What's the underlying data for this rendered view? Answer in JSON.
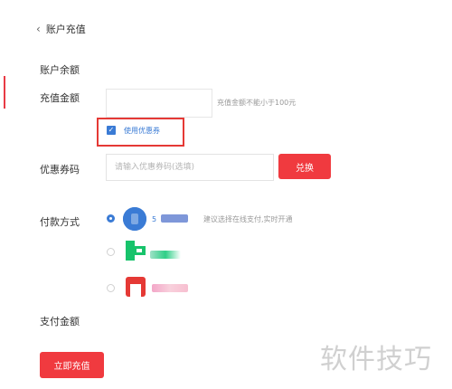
{
  "header": {
    "back_label": "账户充值"
  },
  "fields": {
    "balance_label": "账户余额",
    "amount_label": "充值金额",
    "amount_value": "",
    "amount_hint": "充值金额不能小于100元",
    "use_coupon_label": "使用优惠券",
    "use_coupon_checked": true,
    "coupon_label": "优惠券码",
    "coupon_placeholder": "请输入优惠券码(选填)",
    "redeem_label": "兑换",
    "payment_label": "付款方式",
    "payment_methods": [
      {
        "selected": true,
        "icon": "blue-circle-icon",
        "name_prefix": "5",
        "hint": "建议选择在线支付,实时开通"
      },
      {
        "selected": false,
        "icon": "green-wallet-icon"
      },
      {
        "selected": false,
        "icon": "red-bank-icon"
      }
    ],
    "total_label": "支付金额",
    "total_value": ""
  },
  "actions": {
    "recharge_label": "立即充值"
  },
  "watermark": "软件技巧",
  "colors": {
    "accent_red": "#f03a3f",
    "accent_blue": "#3a7bd5",
    "highlight_box": "#e53935"
  }
}
